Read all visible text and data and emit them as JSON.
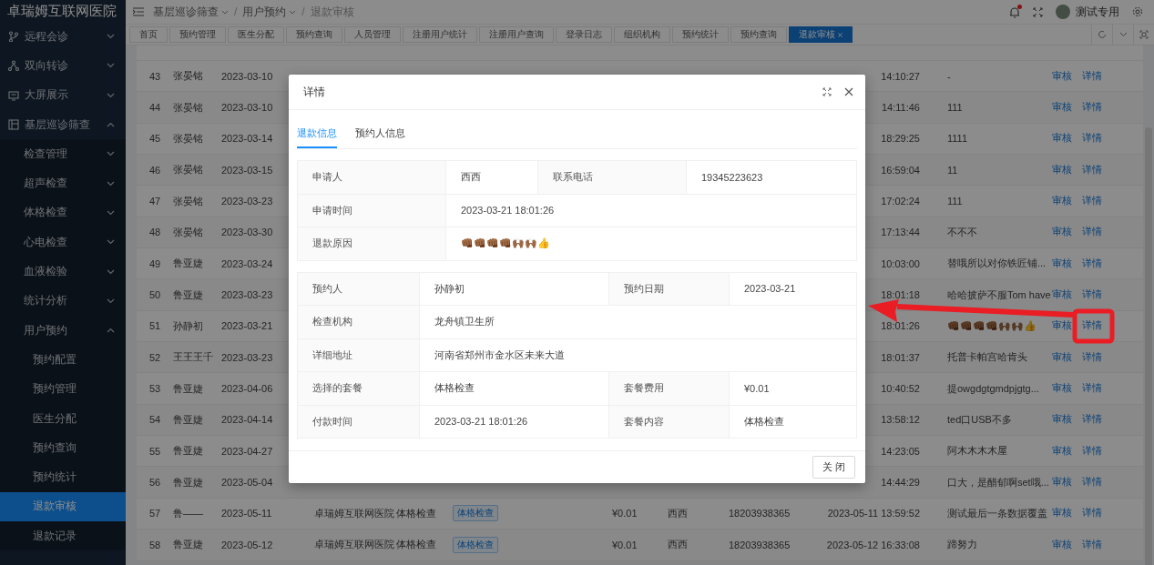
{
  "sidebar": {
    "title": "卓瑞姆互联网医院",
    "items": [
      {
        "label": "远程会诊",
        "selected": false,
        "expanded": false
      },
      {
        "label": "双向转诊",
        "selected": false,
        "expanded": false
      },
      {
        "label": "大屏展示",
        "selected": false,
        "expanded": false
      },
      {
        "label": "基层巡诊筛查",
        "selected": false,
        "expanded": true,
        "children": [
          {
            "label": "检查管理",
            "selected": false,
            "expanded": false
          },
          {
            "label": "超声检查",
            "selected": false,
            "expanded": false
          },
          {
            "label": "体格检查",
            "selected": false,
            "expanded": false
          },
          {
            "label": "心电检查",
            "selected": false,
            "expanded": false
          },
          {
            "label": "血液检验",
            "selected": false,
            "expanded": false
          },
          {
            "label": "统计分析",
            "selected": false,
            "expanded": false
          },
          {
            "label": "用户预约",
            "selected": false,
            "expanded": true,
            "children": [
              {
                "label": "预约配置",
                "selected": false
              },
              {
                "label": "预约管理",
                "selected": false
              },
              {
                "label": "医生分配",
                "selected": false
              },
              {
                "label": "预约查询",
                "selected": false
              },
              {
                "label": "预约统计",
                "selected": false
              },
              {
                "label": "退款审核",
                "selected": true
              },
              {
                "label": "退款记录",
                "selected": false
              }
            ]
          }
        ]
      }
    ]
  },
  "header": {
    "breadcrumb": [
      {
        "label": "基层巡诊筛查",
        "dropdown": true
      },
      {
        "label": "用户预约",
        "dropdown": true
      },
      {
        "label": "退款审核",
        "dropdown": false
      }
    ],
    "separator": "/",
    "notification_dot": true,
    "user": "测试专用"
  },
  "tabs": [
    {
      "label": "首页",
      "selected": false,
      "closable": false
    },
    {
      "label": "预约管理",
      "selected": false,
      "closable": false
    },
    {
      "label": "医生分配",
      "selected": false,
      "closable": false
    },
    {
      "label": "预约查询",
      "selected": false,
      "closable": false
    },
    {
      "label": "人员管理",
      "selected": false,
      "closable": false
    },
    {
      "label": "注册用户统计",
      "selected": false,
      "closable": false
    },
    {
      "label": "注册用户查询",
      "selected": false,
      "closable": false
    },
    {
      "label": "登录日志",
      "selected": false,
      "closable": false
    },
    {
      "label": "组织机构",
      "selected": false,
      "closable": false
    },
    {
      "label": "预约统计",
      "selected": false,
      "closable": false
    },
    {
      "label": "预约查询",
      "selected": false,
      "closable": false
    },
    {
      "label": "退款审核",
      "selected": true,
      "closable": true
    }
  ],
  "table": {
    "rows": [
      {
        "index": "43",
        "name": "张晏铭",
        "date": "2023-03-10",
        "time": "14:10:27",
        "reason": "-",
        "actions": [
          "审核",
          "详情"
        ]
      },
      {
        "index": "44",
        "name": "张晏铭",
        "date": "2023-03-10",
        "time": "14:11:46",
        "reason": "111",
        "actions": [
          "审核",
          "详情"
        ]
      },
      {
        "index": "45",
        "name": "张晏铭",
        "date": "2023-03-14",
        "time": "18:29:25",
        "reason": "1111",
        "actions": [
          "审核",
          "详情"
        ]
      },
      {
        "index": "46",
        "name": "张晏铭",
        "date": "2023-03-15",
        "time": "16:59:04",
        "reason": "11",
        "actions": [
          "审核",
          "详情"
        ]
      },
      {
        "index": "47",
        "name": "张晏铭",
        "date": "2023-03-23",
        "time": "17:02:24",
        "reason": "111",
        "actions": [
          "审核",
          "详情"
        ]
      },
      {
        "index": "48",
        "name": "张晏铭",
        "date": "2023-03-30",
        "time": "17:13:44",
        "reason": "不不不",
        "actions": [
          "审核",
          "详情"
        ]
      },
      {
        "index": "49",
        "name": "鲁亚婕",
        "date": "2023-03-24",
        "time": "10:03:00",
        "reason": "替哦所以对你铁匠铺...",
        "actions": [
          "审核",
          "详情"
        ]
      },
      {
        "index": "50",
        "name": "鲁亚婕",
        "date": "2023-03-23",
        "time": "18:01:18",
        "reason": "哈哈披萨不服Tom have",
        "actions": [
          "审核",
          "详情"
        ]
      },
      {
        "index": "51",
        "name": "孙静初",
        "date": "2023-03-21",
        "time": "18:01:26",
        "reason": "👊🏾👊🏾👊🏾👊🏾🙌🏾🙌🏾👍",
        "actions": [
          "审核",
          "详情"
        ]
      },
      {
        "index": "52",
        "name": "王王王千",
        "date": "2023-03-23",
        "time": "18:01:37",
        "reason": "托普卡帕宫哈肯头",
        "actions": [
          "审核",
          "详情"
        ]
      },
      {
        "index": "53",
        "name": "鲁亚婕",
        "date": "2023-04-06",
        "time": "10:40:52",
        "reason": "提owgdgtgmdpjgtg...",
        "actions": [
          "审核",
          "详情"
        ]
      },
      {
        "index": "54",
        "name": "鲁亚婕",
        "date": "2023-04-14",
        "time": "13:58:12",
        "reason": "ted口USB不多",
        "actions": [
          "审核",
          "详情"
        ]
      },
      {
        "index": "55",
        "name": "鲁亚婕",
        "date": "2023-04-27",
        "time": "14:23:05",
        "reason": "阿木木木木屋",
        "actions": [
          "审核",
          "详情"
        ]
      },
      {
        "index": "56",
        "name": "鲁亚婕",
        "date": "2023-05-04",
        "time": "14:44:29",
        "reason": "口大，是醋郁啊set哦...",
        "actions": [
          "审核",
          "详情"
        ]
      },
      {
        "index": "57",
        "name": "鲁——",
        "date": "2023-05-11",
        "institution": "卓瑞姆互联网医院",
        "package": "体格检查",
        "tag": "体格检查",
        "fee": "¥0.01",
        "person": "西西",
        "phone": "18203938365",
        "time": "2023-05-11 13:59:52",
        "reason": "测试最后一条数据覆盖",
        "actions": [
          "审核",
          "详情"
        ]
      },
      {
        "index": "58",
        "name": "鲁亚婕",
        "date": "2023-05-12",
        "institution": "卓瑞姆互联网医院",
        "package": "体格检查",
        "tag": "体格检查",
        "fee": "¥0.01",
        "person": "西西",
        "phone": "18203938365",
        "time": "2023-05-12 16:33:08",
        "reason": "蹄努力",
        "actions": [
          "审核",
          "详情"
        ]
      }
    ]
  },
  "dialog": {
    "title": "详情",
    "tabs": [
      {
        "label": "退款信息",
        "selected": true
      },
      {
        "label": "预约人信息",
        "selected": false
      }
    ],
    "sections": [
      {
        "rows": [
          {
            "cells": [
              {
                "label": "申请人",
                "value": "西西"
              },
              {
                "label": "联系电话",
                "value": "19345223623"
              }
            ]
          },
          {
            "cells": [
              {
                "label": "申请时间",
                "value": "2023-03-21 18:01:26"
              }
            ]
          },
          {
            "cells": [
              {
                "label": "退款原因",
                "value": "👊🏾👊🏾👊🏾👊🏾🙌🏾🙌🏾👍"
              }
            ]
          }
        ]
      },
      {
        "rows": [
          {
            "cells": [
              {
                "label": "预约人",
                "value": "孙静初"
              },
              {
                "label": "预约日期",
                "value": "2023-03-21"
              }
            ]
          },
          {
            "cells": [
              {
                "label": "检查机构",
                "value": "龙舟镇卫生所"
              }
            ]
          },
          {
            "cells": [
              {
                "label": "详细地址",
                "value": "河南省郑州市金水区未来大道"
              }
            ]
          },
          {
            "cells": [
              {
                "label": "选择的套餐",
                "value": "体格检查"
              },
              {
                "label": "套餐费用",
                "value": "¥0.01"
              }
            ]
          },
          {
            "cells": [
              {
                "label": "付款时间",
                "value": "2023-03-21 18:01:26"
              },
              {
                "label": "套餐内容",
                "value": "体格检查"
              }
            ]
          }
        ]
      }
    ],
    "close_button": "关 闭"
  }
}
